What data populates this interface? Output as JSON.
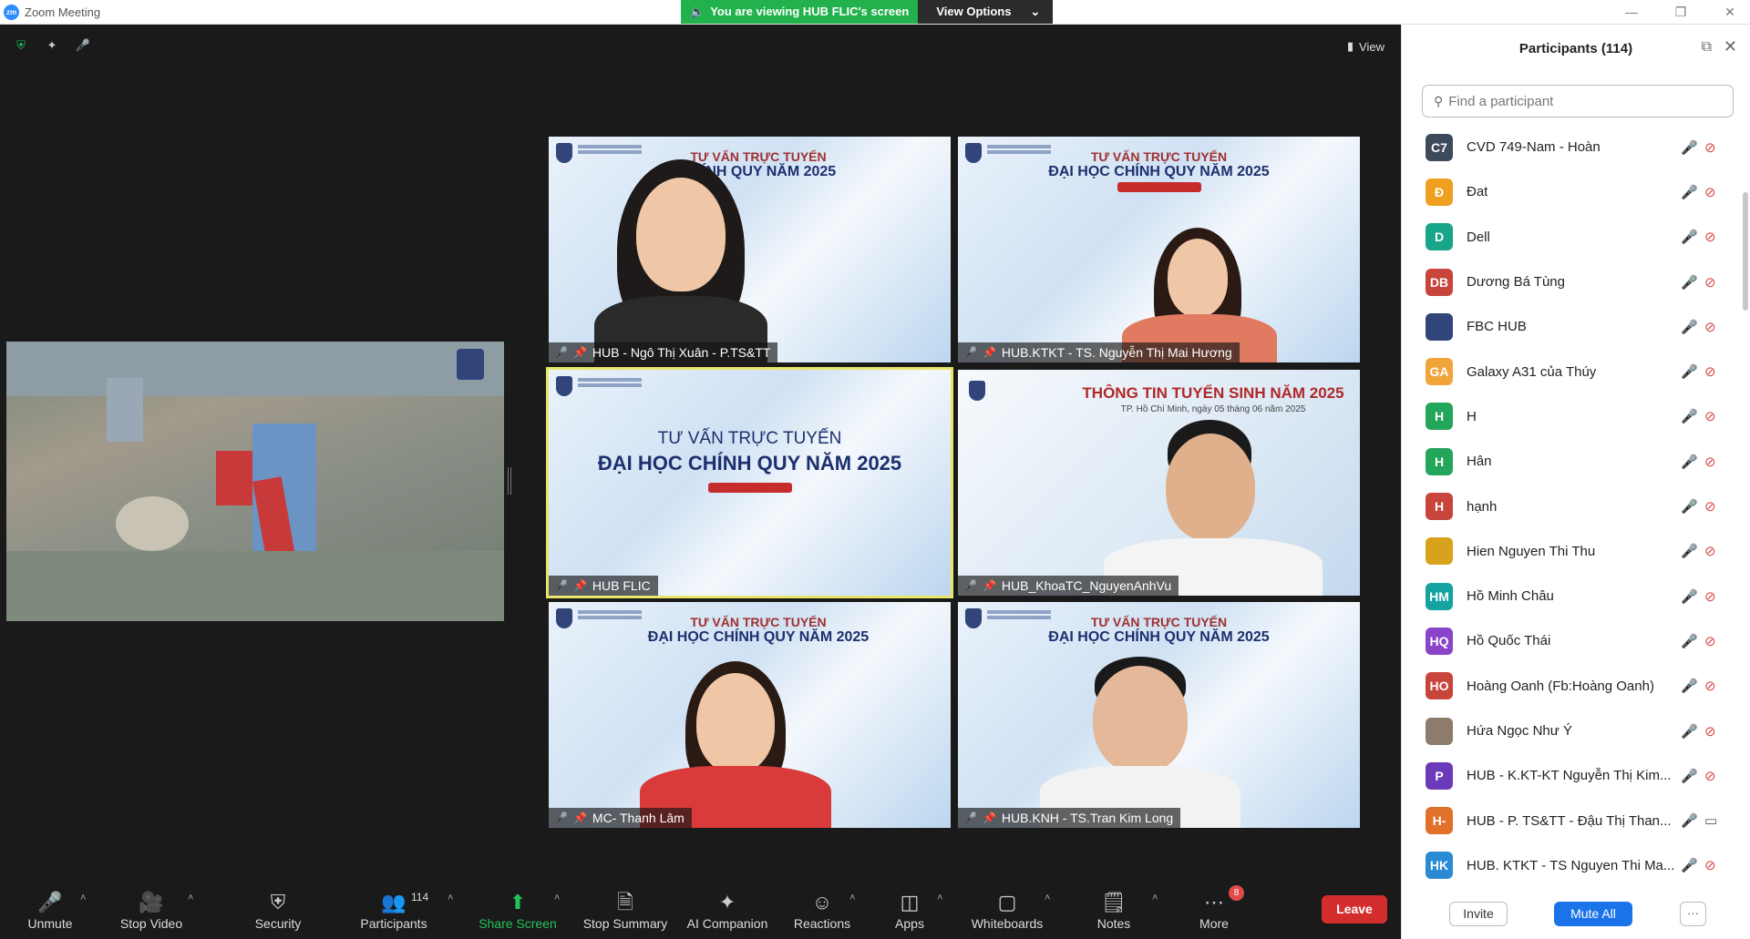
{
  "window": {
    "app_title": "Zoom Meeting",
    "app_logo": "zm",
    "banner_text": "You are viewing HUB FLIC's screen",
    "view_options_label": "View Options",
    "minimize": "—",
    "restore": "❐",
    "close": "✕"
  },
  "meeting": {
    "view_label": "View",
    "tiles": [
      {
        "name": "HUB - Ngô Thị Xuân - P.TS&TT",
        "line1": "TƯ VẤN TRỰC TUYẾN",
        "line2": "CHÍNH QUY NĂM 2025"
      },
      {
        "name": "HUB.KTKT - TS. Nguyễn Thị Mai Hương",
        "line1": "TƯ VẤN TRỰC TUYẾN",
        "line2": "ĐẠI HỌC CHÍNH QUY NĂM 2025"
      },
      {
        "name": "HUB FLIC",
        "line1": "TƯ VẤN TRỰC TUYẾN",
        "line2": "ĐẠI HỌC CHÍNH QUY NĂM 2025"
      },
      {
        "name": "HUB_KhoaTC_NguyenAnhVu",
        "line1": "THÔNG TIN TUYỂN SINH NĂM 2025",
        "line2": "TP. Hồ Chí Minh, ngày 05 tháng 06 năm 2025"
      },
      {
        "name": "MC- Thanh Lâm",
        "line1": "TƯ VẤN TRỰC TUYẾN",
        "line2": "ĐẠI HỌC CHÍNH QUY NĂM 2025"
      },
      {
        "name": "HUB.KNH - TS.Tran Kim Long",
        "line1": "TƯ VẤN TRỰC TUYẾN",
        "line2": "ĐẠI HỌC CHÍNH QUY NĂM 2025"
      }
    ]
  },
  "toolbar": {
    "unmute": "Unmute",
    "stop_video": "Stop Video",
    "security": "Security",
    "participants": "Participants",
    "participants_count": "114",
    "share_screen": "Share Screen",
    "stop_summary": "Stop Summary",
    "ai_companion": "AI Companion",
    "reactions": "Reactions",
    "apps": "Apps",
    "whiteboards": "Whiteboards",
    "notes": "Notes",
    "more": "More",
    "more_badge": "8",
    "leave": "Leave"
  },
  "panel": {
    "title": "Participants (114)",
    "search_placeholder": "Find a participant",
    "participants": [
      {
        "initials": "C7",
        "name": "CVD 749-Nam - Hoàn",
        "color": "#3d4a5c",
        "cam_on": false
      },
      {
        "initials": "Đ",
        "name": "Đat",
        "color": "#f0a020",
        "cam_on": false
      },
      {
        "initials": "D",
        "name": "Dell",
        "color": "#19a58a",
        "cam_on": false
      },
      {
        "initials": "DB",
        "name": "Dương Bá Tùng",
        "color": "#c8453c",
        "cam_on": false
      },
      {
        "initials": "",
        "name": "FBC HUB",
        "color": "#31457a",
        "cam_on": false
      },
      {
        "initials": "GA",
        "name": "Galaxy A31 của Thúy",
        "color": "#f0a43a",
        "cam_on": false
      },
      {
        "initials": "H",
        "name": "H",
        "color": "#23a55a",
        "cam_on": false
      },
      {
        "initials": "H",
        "name": "Hân",
        "color": "#23a55a",
        "cam_on": false
      },
      {
        "initials": "H",
        "name": "hạnh",
        "color": "#c8453c",
        "cam_on": false
      },
      {
        "initials": "",
        "name": "Hien Nguyen Thi Thu",
        "color": "#d8a31a",
        "cam_on": false
      },
      {
        "initials": "HM",
        "name": "Hồ Minh Châu",
        "color": "#14a3a0",
        "cam_on": false
      },
      {
        "initials": "HQ",
        "name": "Hồ Quốc Thái",
        "color": "#8a44c8",
        "cam_on": false
      },
      {
        "initials": "HO",
        "name": "Hoàng Oanh (Fb:Hoàng Oanh)",
        "color": "#c8453c",
        "cam_on": false
      },
      {
        "initials": "",
        "name": "Hứa Ngọc Như Ý",
        "color": "#8d7b6b",
        "cam_on": false
      },
      {
        "initials": "P",
        "name": "HUB - K.KT-KT Nguyễn Thị Kim...",
        "color": "#6a3ab8",
        "cam_on": false
      },
      {
        "initials": "H-",
        "name": "HUB - P. TS&TT - Đậu Thị Than...",
        "color": "#e0702a",
        "cam_on": true
      },
      {
        "initials": "HK",
        "name": "HUB. KTKT - TS Nguyen Thi Ma...",
        "color": "#2a8ad4",
        "cam_on": false
      }
    ],
    "invite": "Invite",
    "mute_all": "Mute All",
    "more": "···"
  }
}
